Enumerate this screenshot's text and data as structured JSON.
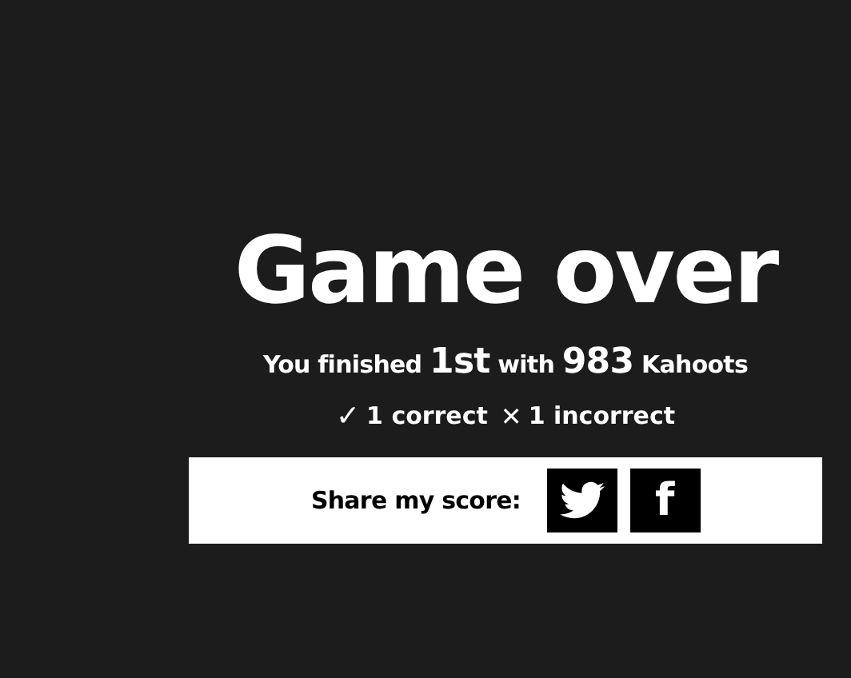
{
  "title": "Game over",
  "summary": "You finished **1st** with **983** Kahoots",
  "results": [
    {
      "kind": "correct",
      "mark": "✓",
      "label": "1 correct"
    },
    {
      "kind": "incorrect",
      "mark": "✕",
      "label": "1 incorrect"
    }
  ],
  "share": {
    "label": "Share my score:",
    "buttons": [
      {
        "kind": "twitter"
      },
      {
        "kind": "facebook",
        "label": "f"
      }
    ]
  }
}
